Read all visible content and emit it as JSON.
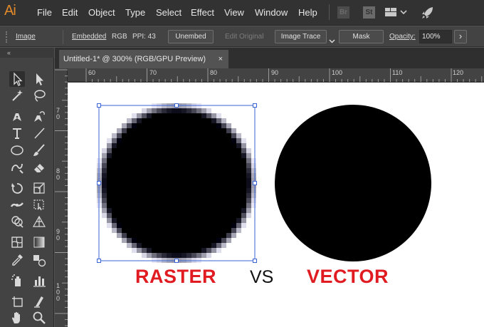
{
  "app": {
    "logo": "Ai"
  },
  "menu": [
    "File",
    "Edit",
    "Object",
    "Type",
    "Select",
    "Effect",
    "View",
    "Window",
    "Help"
  ],
  "bridge": {
    "br": "Br",
    "st": "St"
  },
  "controlbar": {
    "object_type": "Image",
    "embedded": "Embedded",
    "color_mode": "RGB",
    "ppi": "PPI: 43",
    "unembed": "Unembed",
    "edit_original": "Edit Original",
    "image_trace": "Image Trace",
    "mask": "Mask",
    "opacity_label": "Opacity:",
    "opacity_value": "100%",
    "more": "›"
  },
  "tool_panel": {
    "collapse": "«"
  },
  "document": {
    "tab_title": "Untitled-1* @ 300% (RGB/GPU Preview)",
    "close": "×"
  },
  "ruler": {
    "h": [
      "60",
      "70",
      "80",
      "90",
      "100",
      "110",
      "120"
    ],
    "v": [
      "7",
      "0",
      "8",
      "0",
      "9",
      "0",
      "1",
      "0",
      "0"
    ]
  },
  "artwork": {
    "left_label": "RASTER",
    "middle_label": "VS",
    "right_label": "VECTOR",
    "label_color": "#e11b22"
  }
}
